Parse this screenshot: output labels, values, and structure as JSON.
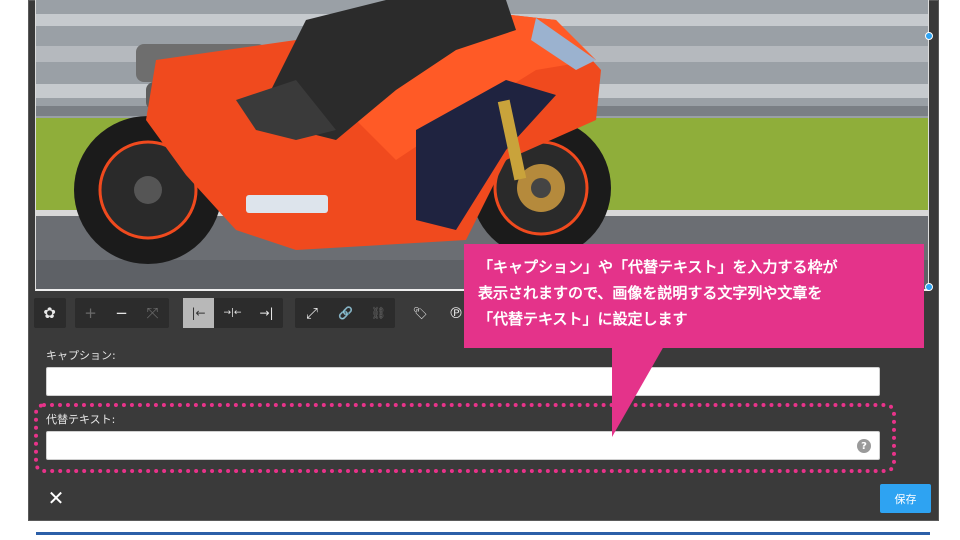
{
  "photo": {
    "alt": "orange-sport-motorcycle-on-race-track",
    "colors": {
      "bike": "#f04a1e",
      "grass": "#8fae3a",
      "track": "#6b6e73",
      "barrier": "#9aa0a6"
    }
  },
  "toolbar": {
    "items": [
      {
        "name": "pinwheel-icon",
        "glyph": "✿"
      },
      {
        "name": "plus-icon",
        "glyph": "+"
      },
      {
        "name": "minus-icon",
        "glyph": "−"
      },
      {
        "name": "expand-cross-icon",
        "glyph": "⤧"
      },
      {
        "name": "align-left-icon",
        "glyph": "|←"
      },
      {
        "name": "align-center-icon",
        "glyph": "→|←"
      },
      {
        "name": "align-right-icon",
        "glyph": "→|"
      },
      {
        "name": "resize-icon",
        "glyph": "⤢"
      },
      {
        "name": "link-icon",
        "glyph": "🔗"
      },
      {
        "name": "unlink-icon",
        "glyph": "⛓"
      },
      {
        "name": "tag-icon",
        "glyph": "🏷"
      },
      {
        "name": "pinterest-icon",
        "glyph": "℗"
      }
    ]
  },
  "form": {
    "caption_label": "キャプション:",
    "caption_value": "",
    "alt_label": "代替テキスト:",
    "alt_value": "",
    "help_glyph": "?"
  },
  "footer": {
    "close_glyph": "✕",
    "save_label": "保存"
  },
  "callout": {
    "line1": "「キャプション」や「代替テキスト」を入力する枠が",
    "line2": "表示されますので、画像を説明する文字列や文章を",
    "line3": "「代替テキスト」に設定します",
    "color": "#e4338a"
  },
  "accent_color": "#2ea3f2"
}
